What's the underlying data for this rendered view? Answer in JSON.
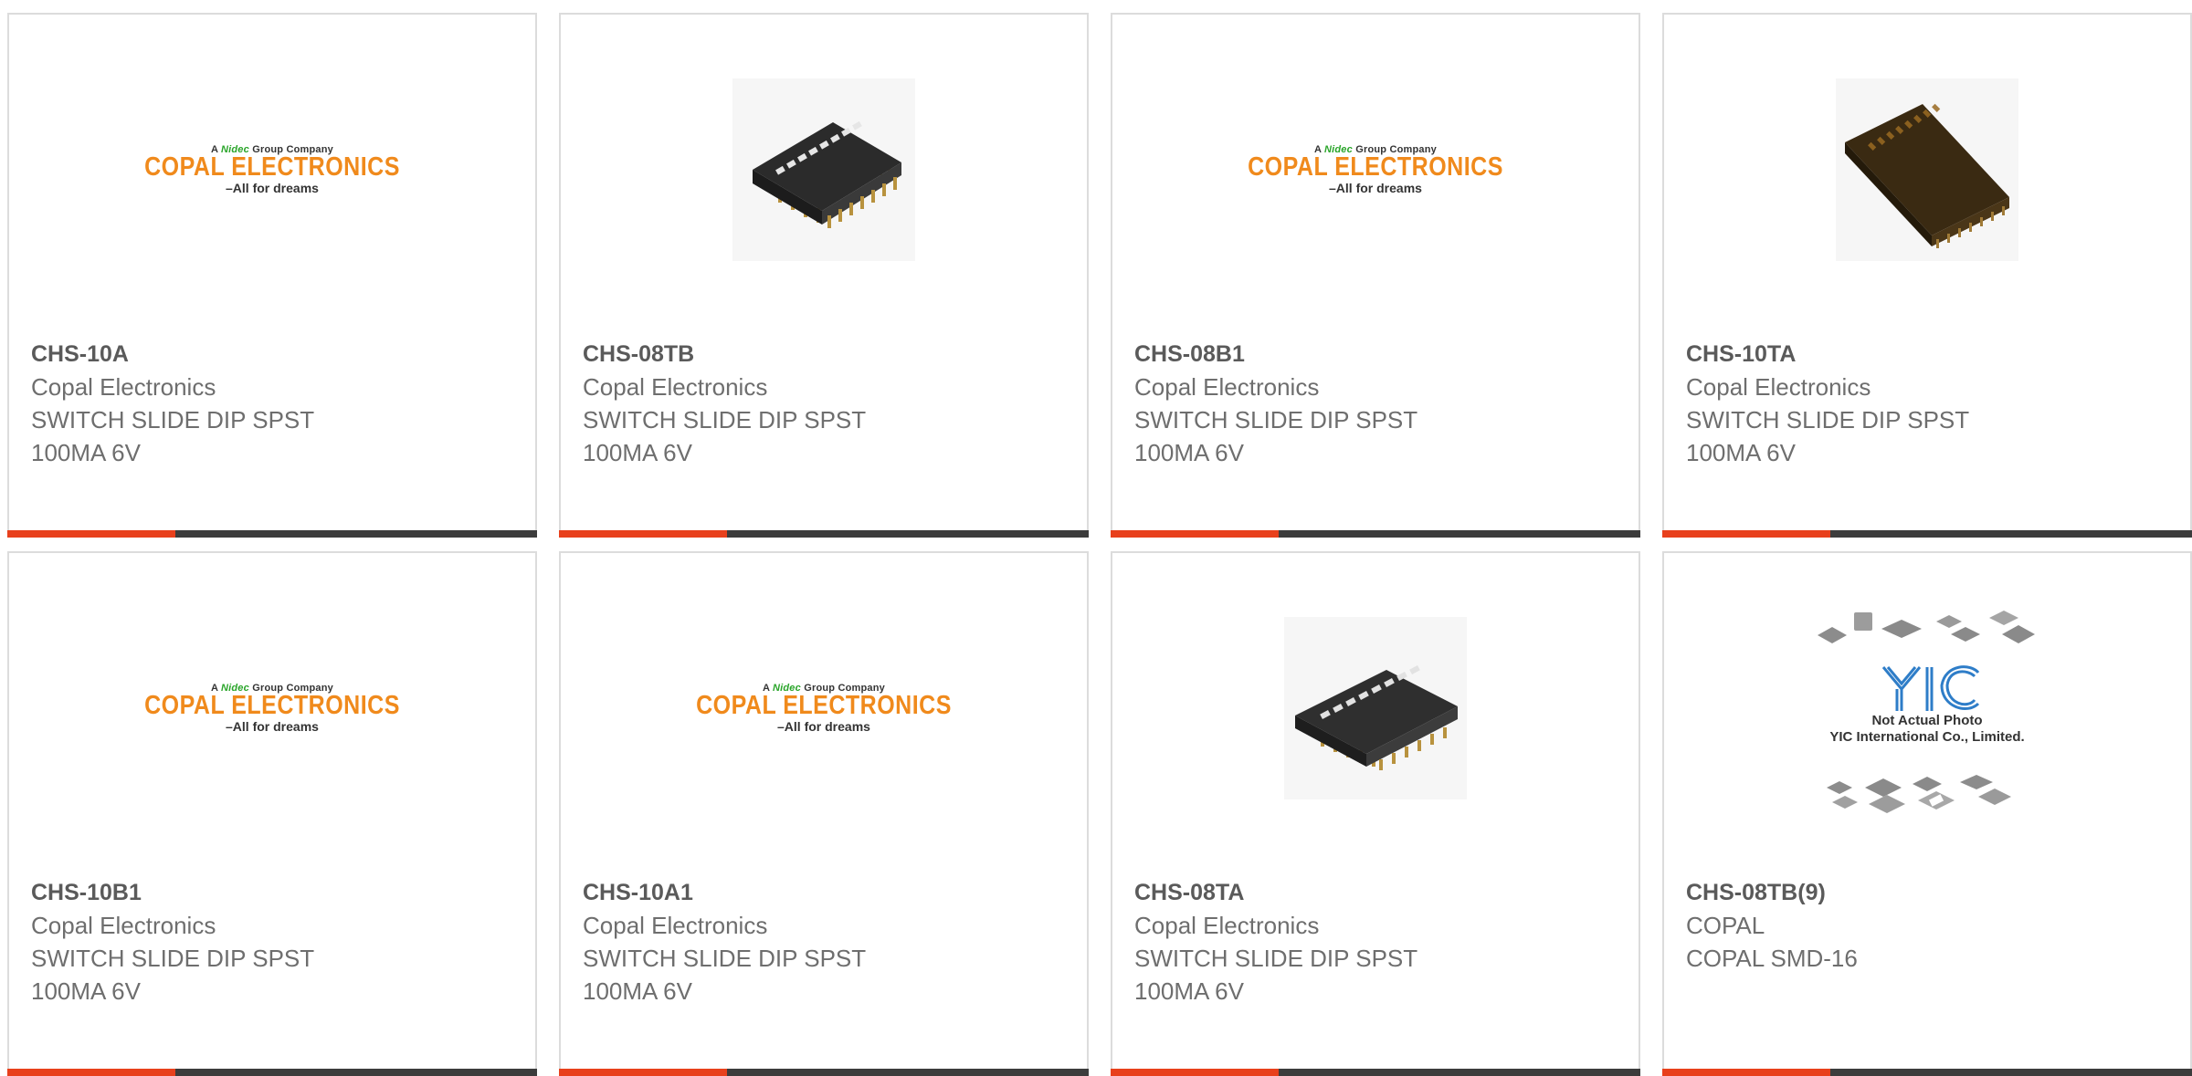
{
  "logo": {
    "group_prefix": "A",
    "group_name": "Nidec",
    "group_suffix": "Group Company",
    "brand": "COPAL ELECTRONICS",
    "tagline": "–All for dreams"
  },
  "placeholder": {
    "line1": "Not Actual Photo",
    "line2": "YIC International Co., Limited."
  },
  "colors": {
    "accent": "#e8401c",
    "bar_dark": "#3c3c3c",
    "brand_orange": "#f08a1c",
    "border": "#dcdcdc"
  },
  "products": [
    {
      "part_number": "CHS-10A",
      "manufacturer": "Copal Electronics",
      "desc_line1": "SWITCH SLIDE DIP SPST",
      "desc_line2": "100MA 6V",
      "image": "copal-logo"
    },
    {
      "part_number": "CHS-08TB",
      "manufacturer": "Copal Electronics",
      "desc_line1": "SWITCH SLIDE DIP SPST",
      "desc_line2": "100MA 6V",
      "image": "dip-switch-photo"
    },
    {
      "part_number": "CHS-08B1",
      "manufacturer": "Copal Electronics",
      "desc_line1": "SWITCH SLIDE DIP SPST",
      "desc_line2": "100MA 6V",
      "image": "copal-logo"
    },
    {
      "part_number": "CHS-10TA",
      "manufacturer": "Copal Electronics",
      "desc_line1": "SWITCH SLIDE DIP SPST",
      "desc_line2": "100MA 6V",
      "image": "dip-switch-photo-transparent"
    },
    {
      "part_number": "CHS-10B1",
      "manufacturer": "Copal Electronics",
      "desc_line1": "SWITCH SLIDE DIP SPST",
      "desc_line2": "100MA 6V",
      "image": "copal-logo"
    },
    {
      "part_number": "CHS-10A1",
      "manufacturer": "Copal Electronics",
      "desc_line1": "SWITCH SLIDE DIP SPST",
      "desc_line2": "100MA 6V",
      "image": "copal-logo"
    },
    {
      "part_number": "CHS-08TA",
      "manufacturer": "Copal Electronics",
      "desc_line1": "SWITCH SLIDE DIP SPST",
      "desc_line2": "100MA 6V",
      "image": "dip-switch-photo-flat"
    },
    {
      "part_number": "CHS-08TB(9)",
      "manufacturer": "COPAL",
      "desc_line1": "COPAL SMD-16",
      "desc_line2": "",
      "image": "not-actual-photo"
    }
  ]
}
